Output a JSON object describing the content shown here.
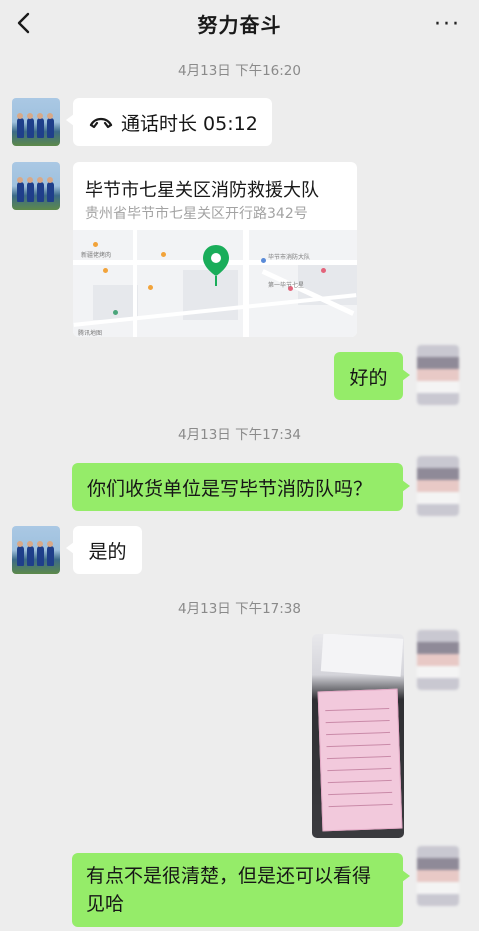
{
  "header": {
    "title": "努力奋斗",
    "more_label": "···"
  },
  "timestamps": [
    "4月13日 下午16:20",
    "4月13日 下午17:34",
    "4月13日 下午17:38"
  ],
  "messages": {
    "call": {
      "icon": "phone-hangup-icon",
      "text": "通话时长 05:12"
    },
    "location": {
      "name": "毕节市七星关区消防救援大队",
      "address": "贵州省毕节市七星关区开行路342号"
    },
    "reply_ok": "好的",
    "question": "你们收货单位是写毕节消防队吗？",
    "answer": "是的",
    "final": "有点不是很清楚，但是还可以看得见哈"
  },
  "colors": {
    "background": "#ededed",
    "self_bubble": "#95ec69",
    "other_bubble": "#ffffff",
    "map_pin": "#1aad5a"
  }
}
